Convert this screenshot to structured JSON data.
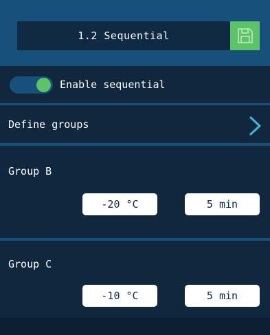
{
  "header": {
    "title": "1.2 Sequential",
    "save_icon": "floppy-disk-icon"
  },
  "enable": {
    "label": "Enable sequential",
    "enabled": true
  },
  "define_groups": {
    "label": "Define groups",
    "icon": "chevron-right-icon"
  },
  "groups": [
    {
      "label": "Group B",
      "temperature": "-20 °C",
      "duration": "5 min"
    },
    {
      "label": "Group C",
      "temperature": "-10 °C",
      "duration": "5 min"
    }
  ],
  "colors": {
    "background": "#17507a",
    "panel": "#10273d",
    "accent_green": "#5cc466",
    "chevron": "#3fb3d6",
    "field": "#ffffff"
  }
}
